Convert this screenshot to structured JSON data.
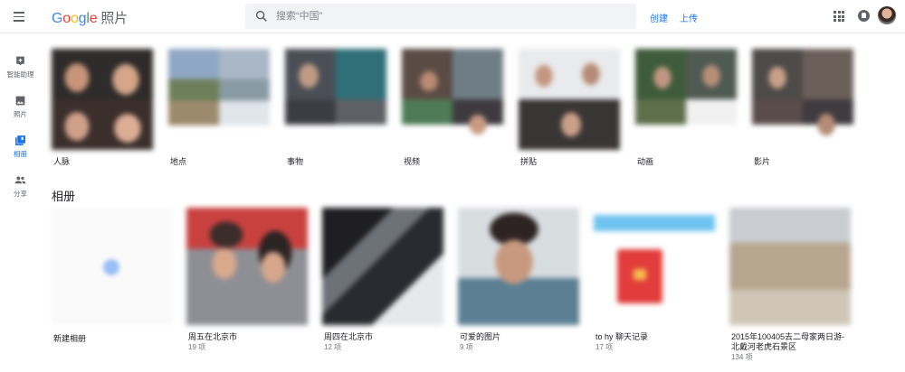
{
  "header": {
    "app_name": "照片",
    "search_placeholder": "搜索“中国”",
    "create_label": "创建",
    "upload_label": "上传",
    "brand_color": "#1a73e8"
  },
  "sidebar": {
    "items": [
      {
        "label": "智能助理",
        "icon": "assistant-icon"
      },
      {
        "label": "照片",
        "icon": "photo-icon"
      },
      {
        "label": "相册",
        "icon": "albums-icon",
        "active": true
      },
      {
        "label": "分享",
        "icon": "people-icon"
      }
    ]
  },
  "categories": [
    {
      "label": "人脉"
    },
    {
      "label": "地点"
    },
    {
      "label": "事物"
    },
    {
      "label": "视频"
    },
    {
      "label": "拼贴"
    },
    {
      "label": "动画"
    },
    {
      "label": "影片"
    }
  ],
  "albums_section": {
    "title": "相册",
    "new_album_label": "新建相册",
    "albums": [
      {
        "name": "周五在北京市",
        "count": "19 项"
      },
      {
        "name": "周四在北京市",
        "count": "12 项"
      },
      {
        "name": "可爱的图片",
        "count": "9 项"
      },
      {
        "name": "to hy 聊天记录",
        "count": "17 项"
      },
      {
        "name": "2015年100405去二母家两日游-北戴河老虎石景区",
        "count": "134 项"
      }
    ]
  }
}
